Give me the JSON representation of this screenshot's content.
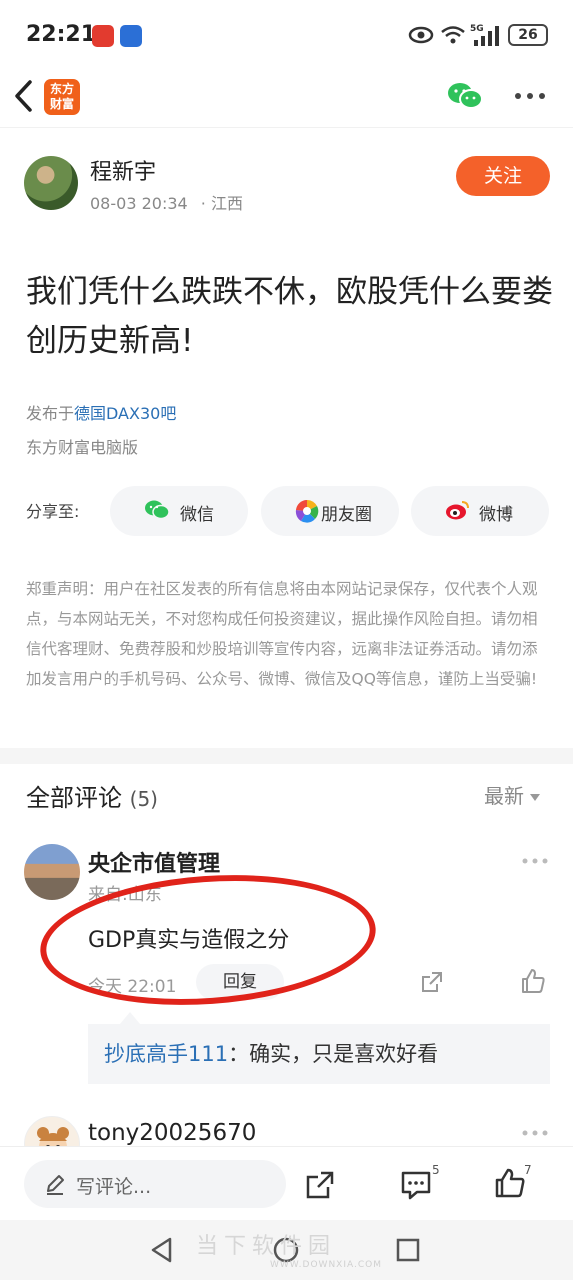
{
  "status_bar": {
    "time": "22:21",
    "network": "5G",
    "battery": "26"
  },
  "nav": {
    "logo_text_line1": "东方",
    "logo_text_line2": "财富"
  },
  "author": {
    "name": "程新宇",
    "date": "08-03 20:34",
    "location": "· 江西",
    "follow_label": "关注"
  },
  "post": {
    "title": "我们凭什么跌跌不休，欧股凭什么要娄创历史新高!",
    "published_prefix": "发布于",
    "forum": "德国DAX30吧",
    "source": "东方财富电脑版"
  },
  "share": {
    "label": "分享至:",
    "options": [
      {
        "label": "微信",
        "icon": "wechat-icon"
      },
      {
        "label": "朋友圈",
        "icon": "moments-icon"
      },
      {
        "label": "微博",
        "icon": "weibo-icon"
      }
    ]
  },
  "disclaimer": "郑重声明：用户在社区发表的所有信息将由本网站记录保存，仅代表个人观点，与本网站无关，不对您构成任何投资建议，据此操作风险自担。请勿相信代客理财、免费荐股和炒股培训等宣传内容，远离非法证券活动。请勿添加发言用户的手机号码、公众号、微博、微信及QQ等信息，谨防上当受骗!",
  "comments_section": {
    "title": "全部评论",
    "count": "(5)",
    "sort_label": "最新",
    "comments": [
      {
        "name": "央企市值管理",
        "location": "来自:山东",
        "text": "GDP真实与造假之分",
        "time": "今天 22:01",
        "reply_label": "回复",
        "reply": {
          "author": "抄底高手111",
          "text": "：确实，只是喜欢好看"
        }
      },
      {
        "name": "tony20025670"
      }
    ]
  },
  "bottom_bar": {
    "comment_placeholder": "写评论...",
    "comment_count": "5",
    "like_count": "7"
  },
  "watermark": {
    "text": "当下软件园",
    "url": "WWW.DOWNXIA.COM"
  },
  "colors": {
    "accent": "#f4612a",
    "link": "#2a6fb5",
    "annotation": "#e0231a"
  }
}
